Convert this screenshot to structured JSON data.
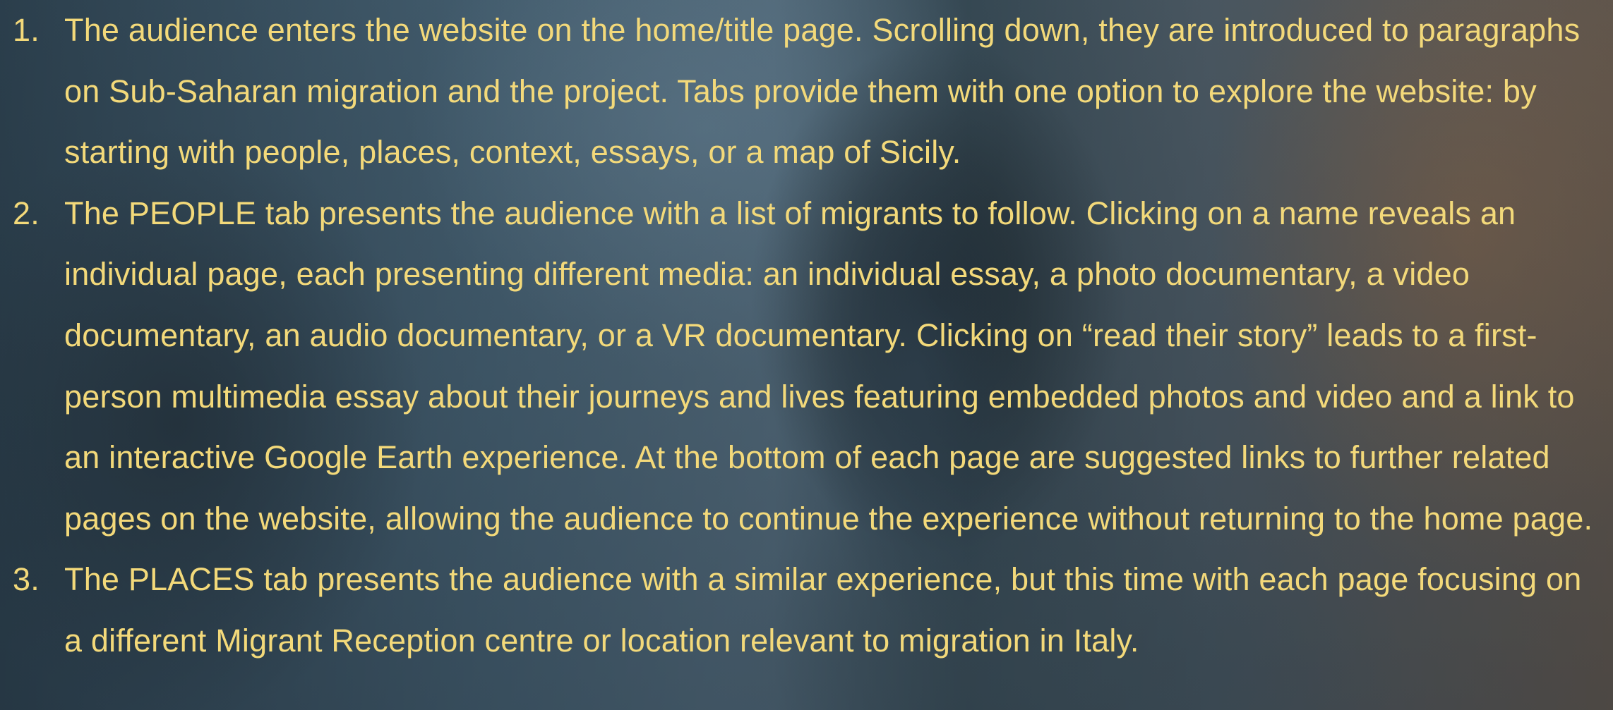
{
  "items": [
    {
      "number": "1.",
      "text": "The audience enters the website on the home/title page. Scrolling down, they are introduced to paragraphs on Sub-Saharan migration and the project. Tabs provide them with one option to explore the website: by starting with people, places, context, essays, or a map of Sicily."
    },
    {
      "number": "2.",
      "text": "The PEOPLE tab presents the audience with a list of migrants to follow. Clicking on a name reveals an individual page, each presenting different media: an individual essay, a photo documentary, a video documentary, an audio documentary, or a VR documentary. Clicking on “read their story” leads to a first-person multimedia essay about their journeys and lives featuring embedded photos and video and a link to an interactive Google Earth experience. At the bottom of each page are suggested links to further related pages on the website, allowing the audience to continue the experience without returning to the home page."
    },
    {
      "number": "3.",
      "text": "The PLACES tab presents the audience with a similar experience, but this time with each page focusing on a different Migrant Reception centre or location relevant to migration in Italy."
    }
  ],
  "colors": {
    "text": "#f3d97a"
  }
}
